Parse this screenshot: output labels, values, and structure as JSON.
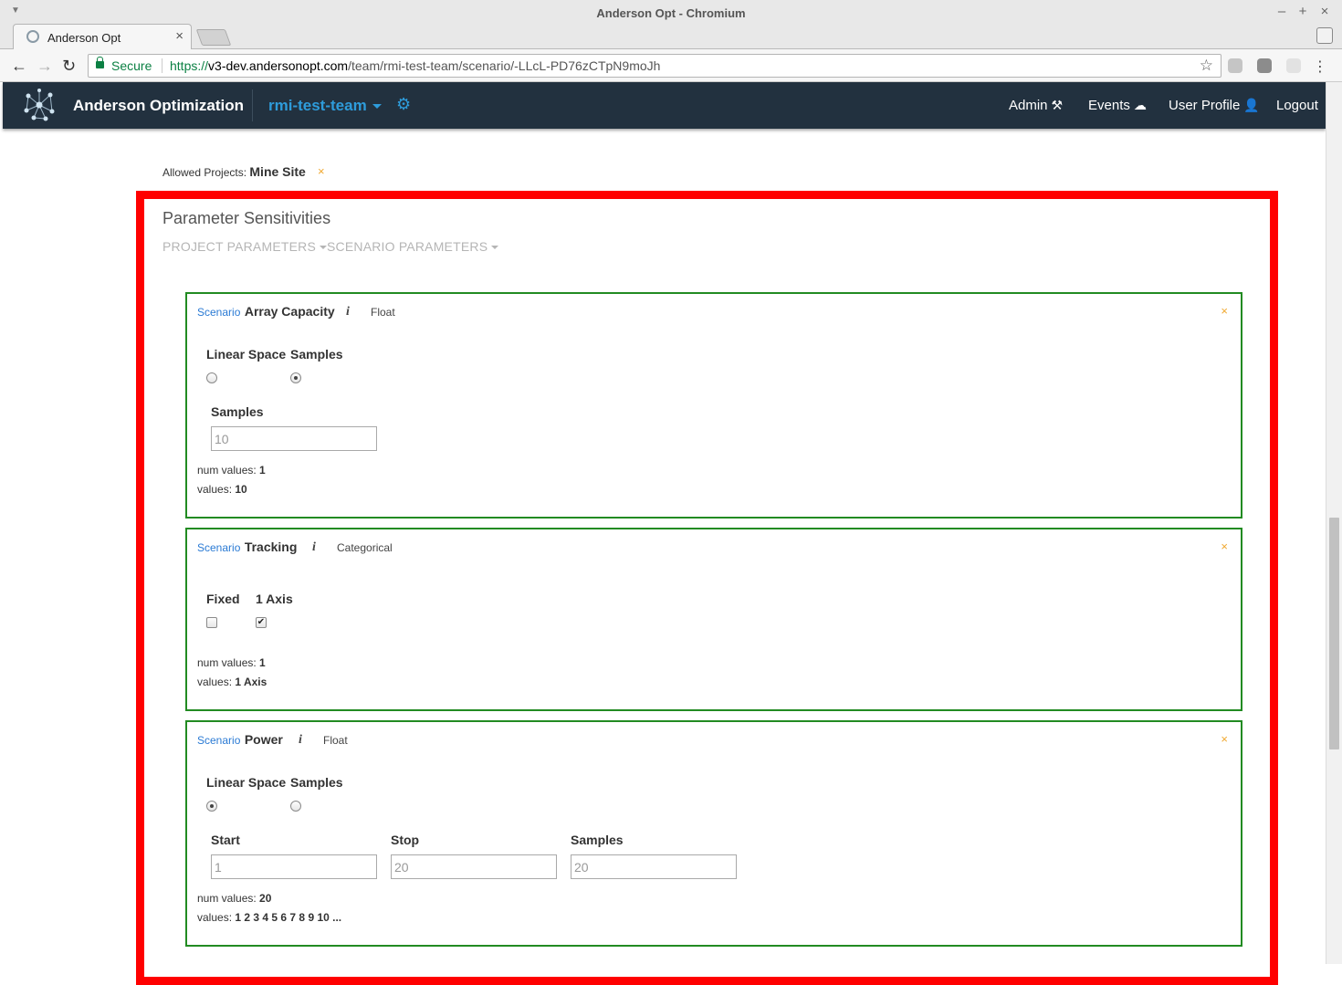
{
  "window": {
    "title": "Anderson Opt - Chromium"
  },
  "browser": {
    "tab_title": "Anderson Opt",
    "secure_label": "Secure",
    "url_scheme": "https://",
    "url_host": "v3-dev.andersonopt.com",
    "url_path": "/team/rmi-test-team/scenario/-LLcL-PD76zCTpN9moJh"
  },
  "navbar": {
    "brand": "Anderson Optimization",
    "team": "rmi-test-team",
    "links": {
      "admin": "Admin",
      "events": "Events",
      "profile": "User Profile",
      "logout": "Logout"
    }
  },
  "allowed": {
    "label": "Allowed Projects:",
    "value": "Mine Site",
    "remove": "×"
  },
  "section": {
    "title": "Parameter Sensitivities",
    "tabs": {
      "project": "PROJECT PARAMETERS",
      "scenario": "SCENARIO PARAMETERS"
    }
  },
  "cards": [
    {
      "kind": "Scenario",
      "name": "Array Capacity",
      "info": "i",
      "type": "Float",
      "close": "×",
      "options": [
        "Linear Space",
        "Samples"
      ],
      "selected": "Samples",
      "fields": {
        "samples_label": "Samples",
        "samples_value": "10"
      },
      "num_values_label": "num values:",
      "num_values": "1",
      "values_label": "values:",
      "values": "10"
    },
    {
      "kind": "Scenario",
      "name": "Tracking",
      "info": "i",
      "type": "Categorical",
      "close": "×",
      "options": [
        "Fixed",
        "1 Axis"
      ],
      "checked": [
        "1 Axis"
      ],
      "num_values_label": "num values:",
      "num_values": "1",
      "values_label": "values:",
      "values": "1 Axis"
    },
    {
      "kind": "Scenario",
      "name": "Power",
      "info": "i",
      "type": "Float",
      "close": "×",
      "options": [
        "Linear Space",
        "Samples"
      ],
      "selected": "Linear Space",
      "fields": {
        "start_label": "Start",
        "start_value": "1",
        "stop_label": "Stop",
        "stop_value": "20",
        "samples_label": "Samples",
        "samples_value": "20"
      },
      "num_values_label": "num values:",
      "num_values": "20",
      "values_label": "values:",
      "values": "1 2 3 4 5 6 7 8 9 10 ..."
    }
  ],
  "colors": {
    "nav_bg": "#22313f",
    "accent": "#2e9cdb",
    "card_border": "#228b22",
    "highlight": "#ff0000",
    "remove": "#f0a830"
  }
}
